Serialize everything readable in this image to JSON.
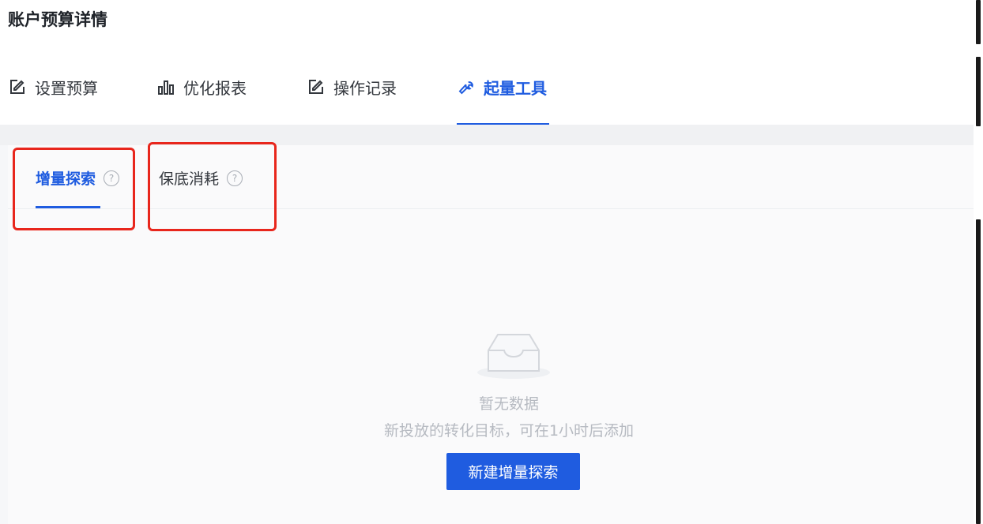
{
  "header": {
    "title": "账户预算详情"
  },
  "tabs": [
    {
      "label": "设置预算",
      "icon": "edit-icon"
    },
    {
      "label": "优化报表",
      "icon": "bar-chart-icon"
    },
    {
      "label": "操作记录",
      "icon": "edit-icon"
    },
    {
      "label": "起量工具",
      "icon": "wrench-icon",
      "active": true
    }
  ],
  "subtabs": [
    {
      "label": "增量探索",
      "active": true,
      "icon": "help-icon"
    },
    {
      "label": "保底消耗",
      "icon": "help-icon"
    }
  ],
  "empty": {
    "icon": "empty-inbox-icon",
    "title": "暂无数据",
    "subtitle": "新投放的转化目标，可在1小时后添加"
  },
  "actions": {
    "create_label": "新建增量探索"
  },
  "colors": {
    "accent": "#1f5ce0",
    "highlight": "#e8261c"
  }
}
